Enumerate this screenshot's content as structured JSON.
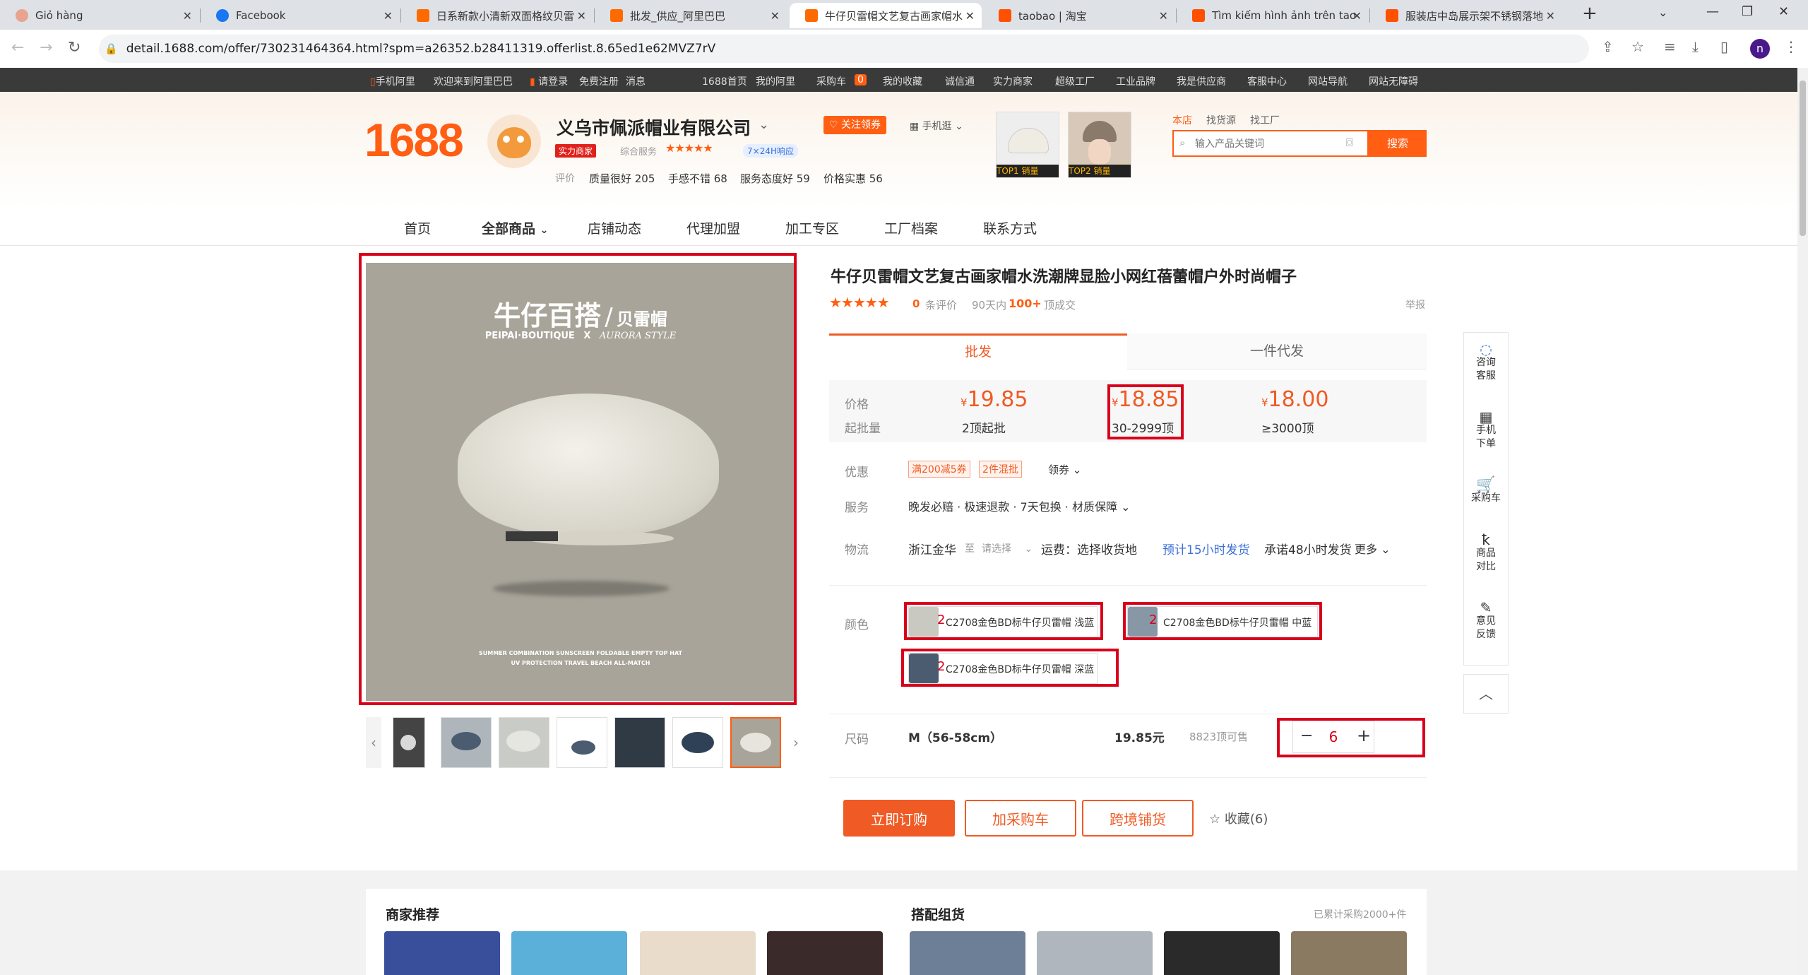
{
  "browser": {
    "tabs": [
      {
        "title": "Giỏ hàng",
        "favicon": "#e07a5f",
        "active": false
      },
      {
        "title": "Facebook",
        "favicon": "#1877f2",
        "active": false
      },
      {
        "title": "日系新款小清新双面格纹贝雷",
        "favicon": "#ff6a00",
        "active": false
      },
      {
        "title": "批发_供应_阿里巴巴",
        "favicon": "#ff6a00",
        "active": false
      },
      {
        "title": "牛仔贝雷帽文艺复古画家帽水",
        "favicon": "#ff6a00",
        "active": true
      },
      {
        "title": "taobao | 淘宝",
        "favicon": "#ff5000",
        "active": false
      },
      {
        "title": "Tìm kiếm hình ảnh trên taob",
        "favicon": "#ff5000",
        "active": false
      },
      {
        "title": "服装店中岛展示架不锈钢落地",
        "favicon": "#ff5000",
        "active": false
      }
    ],
    "url": "detail.1688.com/offer/730231464364.html?spm=a26352.b28411319.offerlist.8.65ed1e62MVZ7rV",
    "profile_initial": "n"
  },
  "sitebar": {
    "items": [
      "手机阿里",
      "欢迎来到阿里巴巴",
      "请登录",
      "免费注册",
      "消息",
      "1688首页",
      "我的阿里",
      "采购车",
      "0",
      "我的收藏",
      "诚信通",
      "实力商家",
      "超级工厂",
      "工业品牌",
      "我是供应商",
      "客服中心",
      "网站导航",
      "网站无障碍"
    ]
  },
  "shop": {
    "logo": "1688",
    "name": "义乌市佩派帽业有限公司",
    "badge": "实力商家",
    "service_label": "综合服务",
    "response_badge": "7×24H响应",
    "follow": "关注领券",
    "mobile": "手机逛",
    "ratings_label": "评价",
    "ratings": [
      "质量很好 205",
      "手感不错 68",
      "服务态度好 59",
      "价格实惠 56"
    ],
    "top1": "TOP1 销量",
    "top2": "TOP2 销量"
  },
  "search": {
    "scopes": [
      "本店",
      "找货源",
      "找工厂"
    ],
    "placeholder": "输入产品关键词",
    "button": "搜索"
  },
  "nav": [
    "首页",
    "全部商品",
    "店铺动态",
    "代理加盟",
    "加工专区",
    "工厂档案",
    "联系方式"
  ],
  "product_image": {
    "title_cn": "牛仔百搭",
    "title_sep": "/",
    "title_sub": "贝雷帽",
    "brand_line": "PEIPAI·BOUTIQUE",
    "brand_x": "X",
    "brand_script": "AURORA STYLE",
    "footer1": "SUMMER COMBINATION SUNSCREEN FOLDABLE EMPTY TOP HAT",
    "footer2": "UV PROTECTION TRAVEL BEACH ALL-MATCH"
  },
  "product": {
    "title": "牛仔贝雷帽文艺复古画家帽水洗潮牌显脸小网红蓓蕾帽户外时尚帽子",
    "reviews": "0",
    "reviews_label": "条评价",
    "sales_label": "90天内",
    "sales": "100+",
    "sales_unit": "顶成交",
    "report": "举报",
    "tab_wholesale": "批发",
    "tab_dropship": "一件代发",
    "price_label": "价格",
    "moq_label": "起批量",
    "tiers": [
      {
        "price": "19.85",
        "range": "2顶起批"
      },
      {
        "price": "18.85",
        "range": "30-2999顶"
      },
      {
        "price": "18.00",
        "range": "≥3000顶"
      }
    ],
    "currency": "¥",
    "promo_label": "优惠",
    "promo1": "满200减5券",
    "promo2": "2件混批",
    "promo_link": "领券",
    "service_label": "服务",
    "service_text": "晚发必赔 · 极速退款 · 7天包换 · 材质保障",
    "logistics_label": "物流",
    "origin": "浙江金华",
    "to": "至",
    "choose": "请选择",
    "shipping": "运费：选择收货地",
    "ship_time": "预计15小时发货",
    "promise": "承诺48小时发货",
    "more": "更多",
    "color_label": "颜色",
    "colors": [
      {
        "name": "C2708金色BD标牛仔贝雷帽 浅蓝",
        "qty": "2",
        "swatch": "#c9c9c2"
      },
      {
        "name": "C2708金色BD标牛仔贝雷帽 中蓝",
        "qty": "2",
        "swatch": "#8797a6"
      },
      {
        "name": "C2708金色BD标牛仔贝雷帽 深蓝",
        "qty": "2",
        "swatch": "#4c5c70"
      }
    ],
    "size_label": "尺码",
    "size": "M（56-58cm）",
    "size_price": "19.85元",
    "stock": "8823顶可售",
    "quantity": "6",
    "buy": "立即订购",
    "cart": "加采购车",
    "cross": "跨境铺货",
    "fav": "收藏(6)"
  },
  "side_tools": [
    "咨询客服",
    "手机下单",
    "采购车",
    "商品对比",
    "意见反馈"
  ],
  "bottom": {
    "left_title": "商家推荐",
    "right_title": "搭配组货",
    "right_note": "已累计采购2000+件"
  }
}
